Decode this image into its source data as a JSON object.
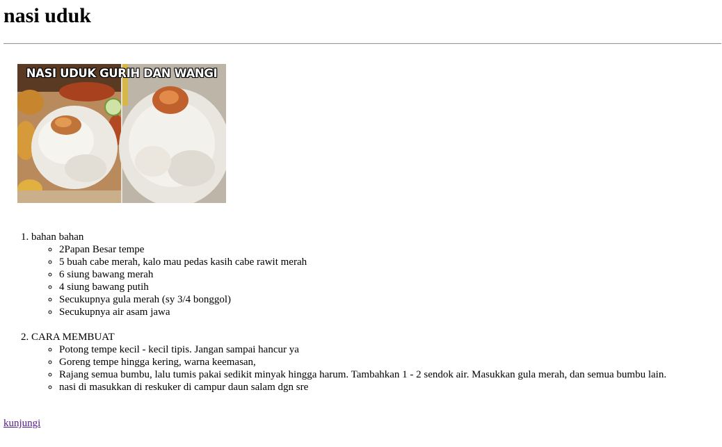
{
  "page": {
    "title": "nasi uduk"
  },
  "hero": {
    "caption": "NASI UDUK GURIH DAN WANGI"
  },
  "sections": [
    {
      "heading": "bahan bahan",
      "items": [
        "2Papan Besar tempe",
        "5 buah cabe merah, kalo mau pedas kasih cabe rawit merah",
        "6 siung bawang merah",
        "4 siung bawang putih",
        "Secukupnya gula merah (sy 3/4 bonggol)",
        "Secukupnya air asam jawa"
      ]
    },
    {
      "heading": "CARA MEMBUAT",
      "items": [
        "Potong tempe kecil - kecil tipis. Jangan sampai hancur ya",
        "Goreng tempe hingga kering, warna keemasan,",
        "Rajang semua bumbu, lalu tumis pakai sedikit minyak hingga harum. Tambahkan 1 - 2 sendok air. Masukkan gula merah, dan semua bumbu lain.",
        "nasi di masukkan di reskuker di campur daun salam dgn sre"
      ]
    }
  ],
  "footer": {
    "link_label": "kunjungi"
  },
  "colors": {
    "link_visited": "#551a8b",
    "rule": "#9a9a9a"
  }
}
